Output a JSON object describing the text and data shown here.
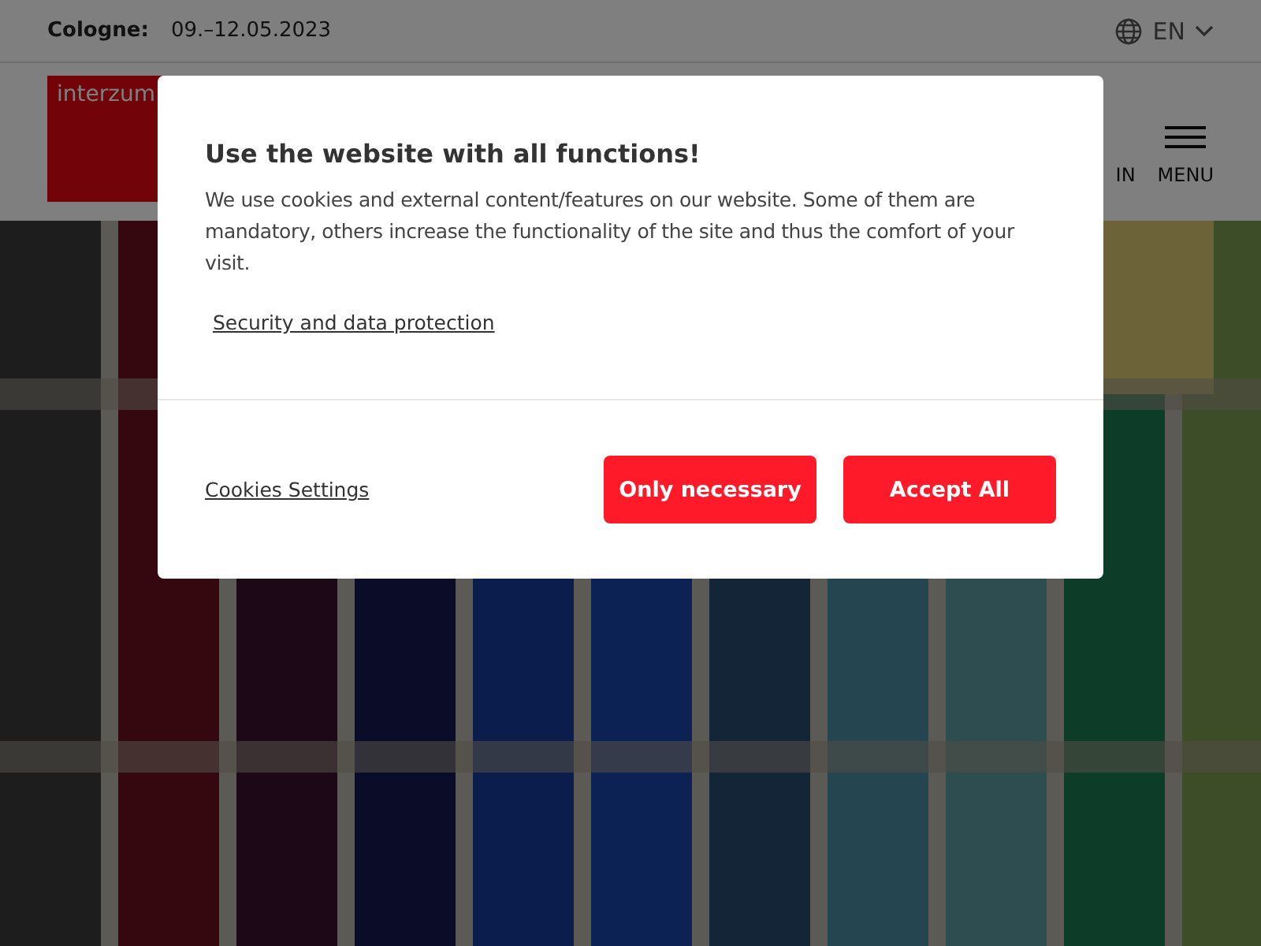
{
  "top_bar": {
    "location_label": "Cologne:",
    "dates": "09.–12.05.2023",
    "language": "EN"
  },
  "header": {
    "logo_text": "interzum",
    "login_label": "IN",
    "menu_label": "MENU"
  },
  "cookie_dialog": {
    "title": "Use the website with all functions!",
    "text": "We use cookies and external content/features on our website. Some of them are mandatory, others increase the functionality of the site and thus the comfort of your visit.",
    "privacy_link": "Security and data protection",
    "settings_link": "Cookies Settings",
    "buttons": [
      {
        "label": "Only necessary"
      },
      {
        "label": "Accept All"
      }
    ]
  }
}
